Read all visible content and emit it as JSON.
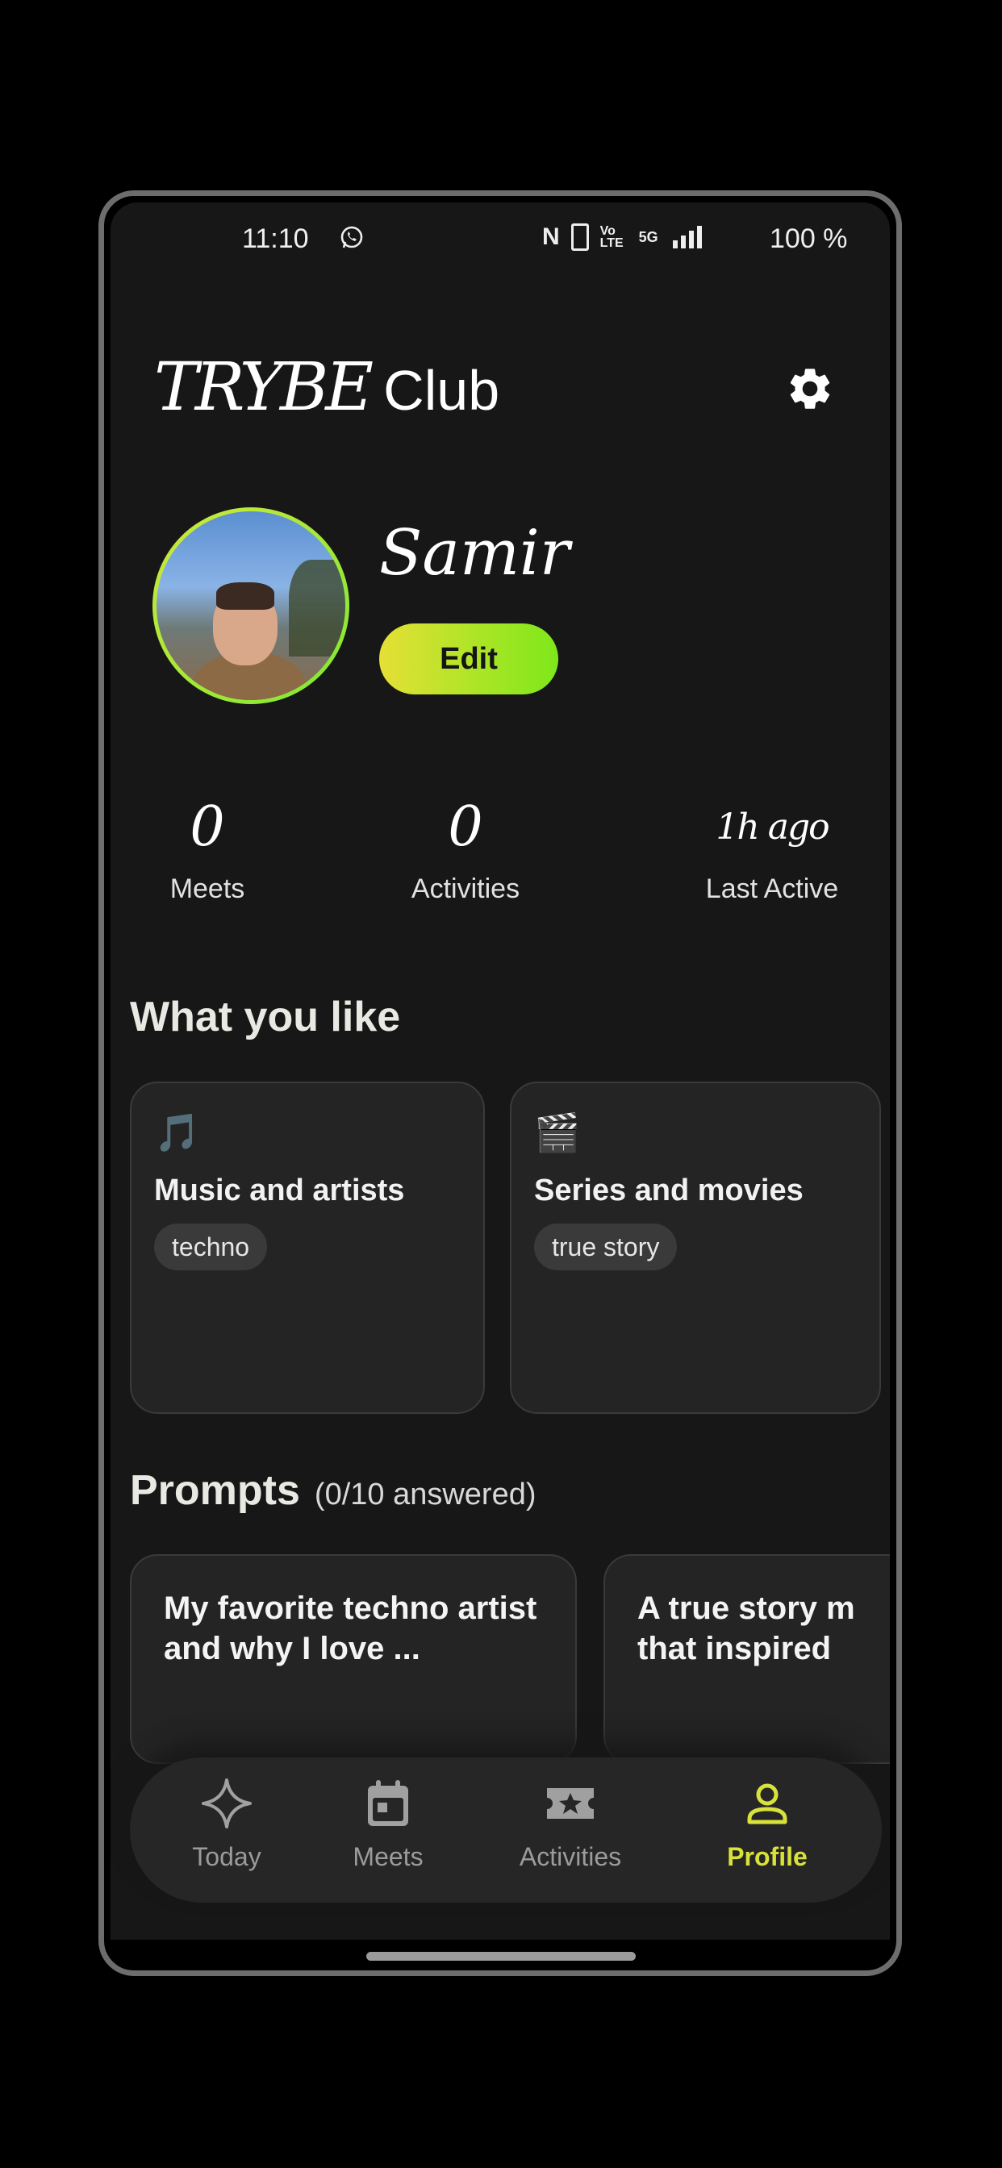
{
  "status_bar": {
    "time": "11:10",
    "signal_text": "Vo LTE",
    "network": "5G",
    "battery": "100 %"
  },
  "header": {
    "brand_trybe": "TRYBE",
    "brand_club": "Club"
  },
  "profile": {
    "name": "Samir",
    "edit_label": "Edit"
  },
  "stats": [
    {
      "value": "0",
      "label": "Meets"
    },
    {
      "value": "0",
      "label": "Activities"
    },
    {
      "value": "1h ago",
      "label": "Last Active"
    }
  ],
  "likes": {
    "title": "What you like",
    "cards": [
      {
        "emoji": "🎵",
        "title": "Music and artists",
        "tag": "techno"
      },
      {
        "emoji": "🎬",
        "title": "Series and movies",
        "tag": "true story"
      }
    ]
  },
  "prompts": {
    "title": "Prompts",
    "answered": "(0/10 answered)",
    "cards": [
      {
        "text": "My favorite techno artist and why I love ..."
      },
      {
        "text": "A true story movie that inspired"
      }
    ]
  },
  "nav": [
    {
      "label": "Today",
      "icon": "sparkle-icon"
    },
    {
      "label": "Meets",
      "icon": "calendar-icon"
    },
    {
      "label": "Activities",
      "icon": "ticket-star-icon"
    },
    {
      "label": "Profile",
      "icon": "person-icon",
      "active": true
    }
  ],
  "colors": {
    "background": "#171717",
    "card": "#242424",
    "accent_start": "#e5e036",
    "accent_end": "#7ee81a",
    "active_nav": "#d9e23a"
  }
}
